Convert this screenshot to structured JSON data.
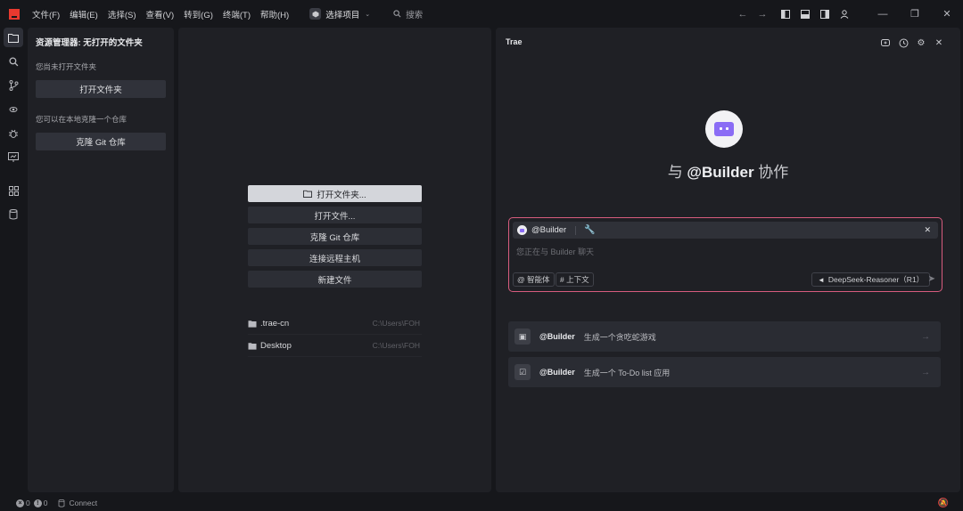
{
  "menu": [
    "文件(F)",
    "编辑(E)",
    "选择(S)",
    "查看(V)",
    "转到(G)",
    "终端(T)",
    "帮助(H)"
  ],
  "project_select": "选择项目",
  "search_label": "搜索",
  "explorer": {
    "title": "资源管理器: 无打开的文件夹",
    "no_folder_note": "您尚未打开文件夹",
    "open_folder_btn": "打开文件夹",
    "clone_note": "您可以在本地克隆一个仓库",
    "clone_btn": "克隆 Git 仓库"
  },
  "welcome": {
    "buttons": [
      "打开文件夹...",
      "打开文件...",
      "克隆 Git 仓库",
      "连接远程主机",
      "新建文件"
    ],
    "recent": [
      {
        "name": ".trae-cn",
        "path": "C:\\Users\\FOH"
      },
      {
        "name": "Desktop",
        "path": "C:\\Users\\FOH"
      }
    ]
  },
  "chat": {
    "title": "Trae",
    "collab_prefix": "与",
    "collab_agent": "@Builder",
    "collab_suffix": "协作",
    "chip_label": "@Builder",
    "placeholder": "您正在与 Builder 聊天",
    "agent_pill": "@ 智能体",
    "context_pill": "# 上下文",
    "model": "DeepSeek-Reasoner（R1）",
    "suggestions": [
      {
        "mention": "@Builder",
        "text": "生成一个贪吃蛇游戏",
        "icon": "gamepad-icon"
      },
      {
        "mention": "@Builder",
        "text": "生成一个 To-Do list 应用",
        "icon": "checklist-icon"
      }
    ]
  },
  "status": {
    "errors": "0",
    "warnings": "0",
    "connect": "Connect"
  },
  "colors": {
    "accent_border": "#d85c7e",
    "robot": "#8a6cf5",
    "logo": "#e8392f"
  }
}
